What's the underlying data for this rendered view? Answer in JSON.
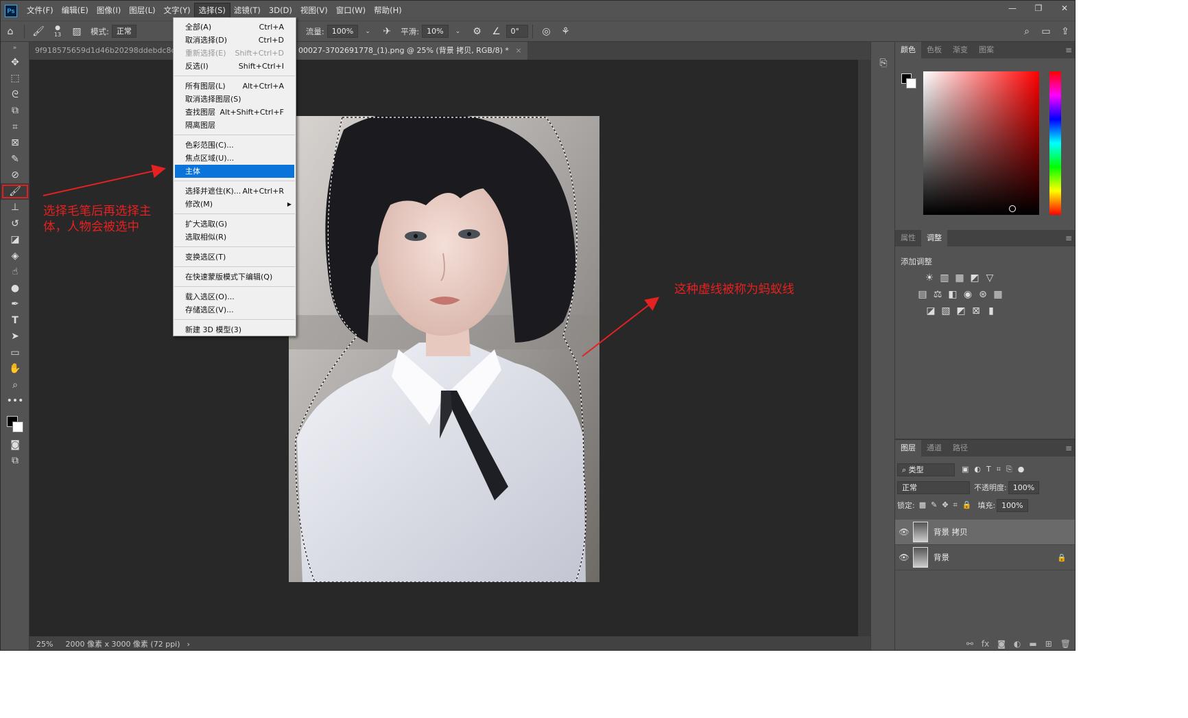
{
  "app": {
    "logo": "Ps",
    "menus": [
      "文件(F)",
      "编辑(E)",
      "图像(I)",
      "图层(L)",
      "文字(Y)",
      "选择(S)",
      "滤镜(T)",
      "3D(D)",
      "视图(V)",
      "窗口(W)",
      "帮助(H)"
    ],
    "active_menu_index": 5,
    "window_controls": [
      "—",
      "❐",
      "✕"
    ]
  },
  "options_bar": {
    "brush_size": "13",
    "mode_label": "模式:",
    "mode_value": "正常",
    "flow_label": "流量:",
    "flow_value": "100%",
    "smooth_label": "平滑:",
    "smooth_value": "10%",
    "angle_value": "0°"
  },
  "tabs": [
    {
      "label": "9f918575659d1d46b20298ddebdc8cae.jpg",
      "active": false
    },
    {
      "label": "00027-3702691778_(1).png @ 25% (背景 拷贝, RGB/8) *",
      "active": true
    }
  ],
  "select_menu": {
    "items": [
      {
        "label": "全部(A)",
        "shortcut": "Ctrl+A"
      },
      {
        "label": "取消选择(D)",
        "shortcut": "Ctrl+D"
      },
      {
        "label": "重新选择(E)",
        "shortcut": "Shift+Ctrl+D",
        "disabled": true
      },
      {
        "label": "反选(I)",
        "shortcut": "Shift+Ctrl+I"
      },
      {
        "sep": true
      },
      {
        "label": "所有图层(L)",
        "shortcut": "Alt+Ctrl+A"
      },
      {
        "label": "取消选择图层(S)",
        "shortcut": ""
      },
      {
        "label": "查找图层",
        "shortcut": "Alt+Shift+Ctrl+F"
      },
      {
        "label": "隔离图层",
        "shortcut": ""
      },
      {
        "sep": true
      },
      {
        "label": "色彩范围(C)...",
        "shortcut": ""
      },
      {
        "label": "焦点区域(U)...",
        "shortcut": ""
      },
      {
        "label": "主体",
        "shortcut": "",
        "highlight": true
      },
      {
        "sep": true
      },
      {
        "label": "选择并遮住(K)...",
        "shortcut": "Alt+Ctrl+R"
      },
      {
        "label": "修改(M)",
        "shortcut": "",
        "submenu": true
      },
      {
        "sep": true
      },
      {
        "label": "扩大选取(G)",
        "shortcut": ""
      },
      {
        "label": "选取相似(R)",
        "shortcut": ""
      },
      {
        "sep": true
      },
      {
        "label": "变换选区(T)",
        "shortcut": ""
      },
      {
        "sep": true
      },
      {
        "label": "在快速蒙版模式下编辑(Q)",
        "shortcut": ""
      },
      {
        "sep": true
      },
      {
        "label": "载入选区(O)...",
        "shortcut": ""
      },
      {
        "label": "存储选区(V)...",
        "shortcut": ""
      },
      {
        "sep": true
      },
      {
        "label": "新建 3D 模型(3)",
        "shortcut": ""
      }
    ]
  },
  "annotations": {
    "left_note": "选择毛笔后再选择主体，人物会被选中",
    "left_note_line1": "选择毛笔后再选择主",
    "left_note_line2": "体，人物会被选中",
    "right_note": "这种虚线被称为蚂蚁线",
    "color": "#e52121"
  },
  "status": {
    "zoom": "25%",
    "doc_info": "2000 像素 x 3000 像素 (72 ppi)",
    "arrow": "›"
  },
  "color_panel": {
    "tabs": [
      "颜色",
      "色板",
      "渐变",
      "图案"
    ],
    "active": 0
  },
  "adjust_panel": {
    "tabs": [
      "属性",
      "调整"
    ],
    "active": 1,
    "title": "添加调整"
  },
  "layers_panel": {
    "tabs": [
      "图层",
      "通道",
      "路径"
    ],
    "active": 0,
    "filter_value": "类型",
    "blend_mode": "正常",
    "opacity_label": "不透明度:",
    "opacity_value": "100%",
    "lock_label": "锁定:",
    "fill_label": "填充:",
    "fill_value": "100%",
    "layers": [
      {
        "name": "背景 拷贝",
        "selected": true,
        "locked": false
      },
      {
        "name": "背景",
        "selected": false,
        "locked": true
      }
    ]
  }
}
